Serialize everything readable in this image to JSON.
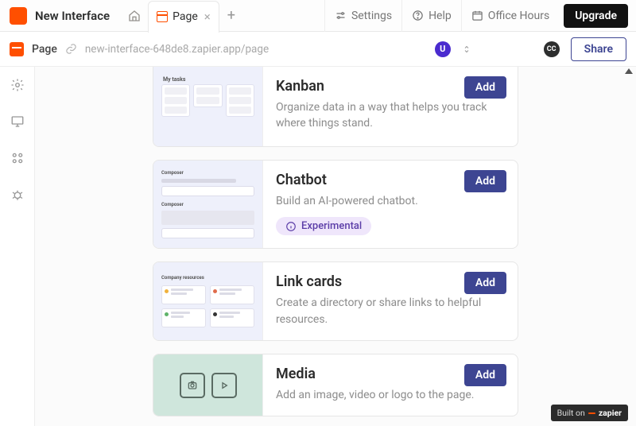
{
  "topbar": {
    "project_name": "New Interface",
    "tab_label": "Page",
    "settings": "Settings",
    "help": "Help",
    "office_hours": "Office Hours",
    "upgrade": "Upgrade"
  },
  "urlbar": {
    "page_label": "Page",
    "url": "new-interface-648de8.zapier.app/page",
    "avatar_initial": "U",
    "cc": "CC",
    "share": "Share"
  },
  "components": [
    {
      "id": "kanban",
      "title": "Kanban",
      "desc": "Organize data in a way that helps you track where things stand.",
      "add": "Add",
      "thumb_label": "My tasks"
    },
    {
      "id": "chatbot",
      "title": "Chatbot",
      "desc": "Build an AI-powered chatbot.",
      "add": "Add",
      "badge": "Experimental"
    },
    {
      "id": "linkcards",
      "title": "Link cards",
      "desc": "Create a directory or share links to helpful resources.",
      "add": "Add",
      "thumb_label": "Company resources"
    },
    {
      "id": "media",
      "title": "Media",
      "desc": "Add an image, video or logo to the page.",
      "add": "Add"
    }
  ],
  "footer": {
    "built_on": "Built on",
    "brand": "zapier"
  }
}
